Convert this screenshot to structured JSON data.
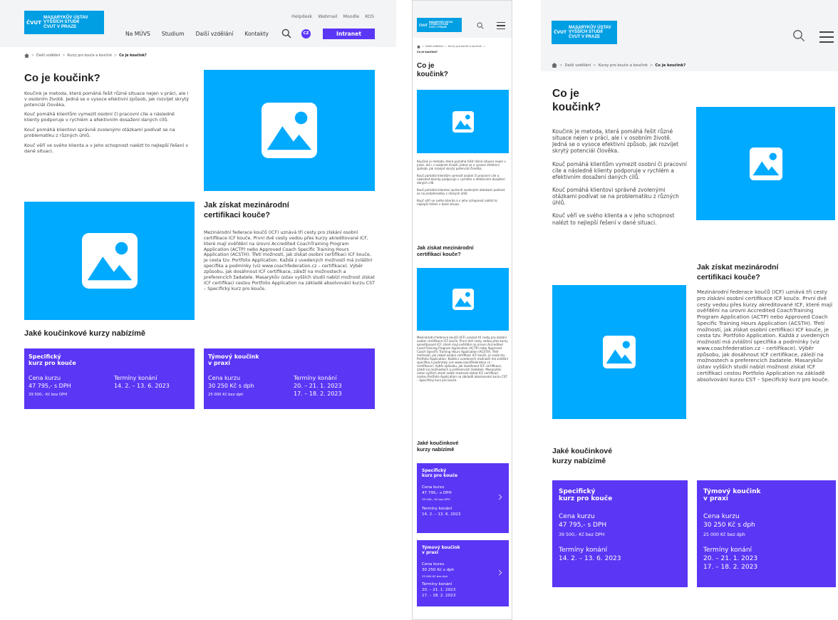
{
  "logo": {
    "line1": "Masarykův ústav",
    "line2": "vyšších studií",
    "line3": "ČVUT v Praze",
    "crest": "ČVUT"
  },
  "utility": [
    "Helpdesk",
    "Webmail",
    "Moodle",
    "KOS"
  ],
  "nav": [
    "Na MÚVS",
    "Studium",
    "Další vzdělání",
    "Kontakty"
  ],
  "lang": "CZ",
  "intranet_label": "Intranet",
  "breadcrumb": {
    "home_icon": "home-icon",
    "items": [
      "Další vzdělání",
      "Kurzy pro kouče a koučink"
    ],
    "current": "Co je koučink?",
    "sep": ">"
  },
  "section1": {
    "title": "Co je koučink?",
    "title_l1": "Co je",
    "title_l2": "koučink?",
    "p1": "Koučink je metoda, která pomáhá řešit různé situace nejen v práci, ale i v osobním životě. Jedná se o vysoce efektivní způsob, jak rozvíjet skrytý potenciál člověka.",
    "p2": "Kouč pomáhá klientům vymezit osobní či pracovní cíle a následně klienty podporuje v rychlém a efektivním dosažení daných cílů.",
    "p3": "Kouč pomáhá klientovi správně zvolenými otázkami podívat se na problematiku z různých úhlů.",
    "p4": "Kouč věří ve svého klienta a v jeho schopnost nalézt to nejlepší řešení v dané situaci."
  },
  "section2": {
    "title_l1": "Jak získat mezinárodní",
    "title_l2": "certifikaci kouče?",
    "text": "Mezinárodní federace koučů (ICF) uznává tři cesty pro získání osobní certifikace ICF kouče. První dvě cesty vedou přes kurzy akreditované ICF, které mají ověřdění na úrovni Accredited CoachTraining Program Application (ACTP) nebo Approved Coach Specific Training Hours Application (ACSTH). Třetí možností, jak získat osobní certifikaci ICF kouče, je cesta tzv. Portfolio Application. Každá z uvedených možností má zvláštní specifika a podmínky (viz www.coachfederation.cz – certifikace). Výběr způsobu, jak dosáhnout ICF certifikace, záleží na možnostech a preferencích žadatele. Masarykův ústav vyšších studií nabízí možnost získat ICF certifikaci cestou Portfolio Application na základě absolvování kurzu CST – Specifický kurz pro kouče."
  },
  "section3": {
    "title": "Jaké koučinkové kurzy nabízíme",
    "title_l1": "Jaké koučinkové",
    "title_l2": "kurzy nabízímě",
    "title_desktop": "Jaké koučinkové kurzy nabízímě"
  },
  "cards": [
    {
      "title_l1": "Specifický",
      "title_l2": "kurz pro kouče",
      "price_label": "Cena kurzu",
      "price": "47 795,- s DPH",
      "price_sub": "39 500,- Kč bez DPH",
      "dates_label": "Termíny konání",
      "dates": [
        "14. 2. – 13. 6. 2023"
      ]
    },
    {
      "title_l1": "Týmový koučink",
      "title_l2": "v praxi",
      "price_label": "Cena kurzu",
      "price": "30 250 Kč s dph",
      "price_sub": "25 000 Kč bez dph",
      "dates_label": "Termíny konání",
      "dates": [
        "20. – 21. 1. 2023",
        "17. – 18. 2. 2023"
      ]
    }
  ],
  "icons": {
    "image_placeholder": "image-placeholder-icon",
    "search": "search-icon",
    "menu": "hamburger-menu-icon",
    "chevron": "chevron-right-icon"
  },
  "colors": {
    "accent_blue": "#00aaff",
    "brand_blue": "#009ee3",
    "purple": "#5b36f5",
    "bar_gray": "#f3f4f6"
  }
}
